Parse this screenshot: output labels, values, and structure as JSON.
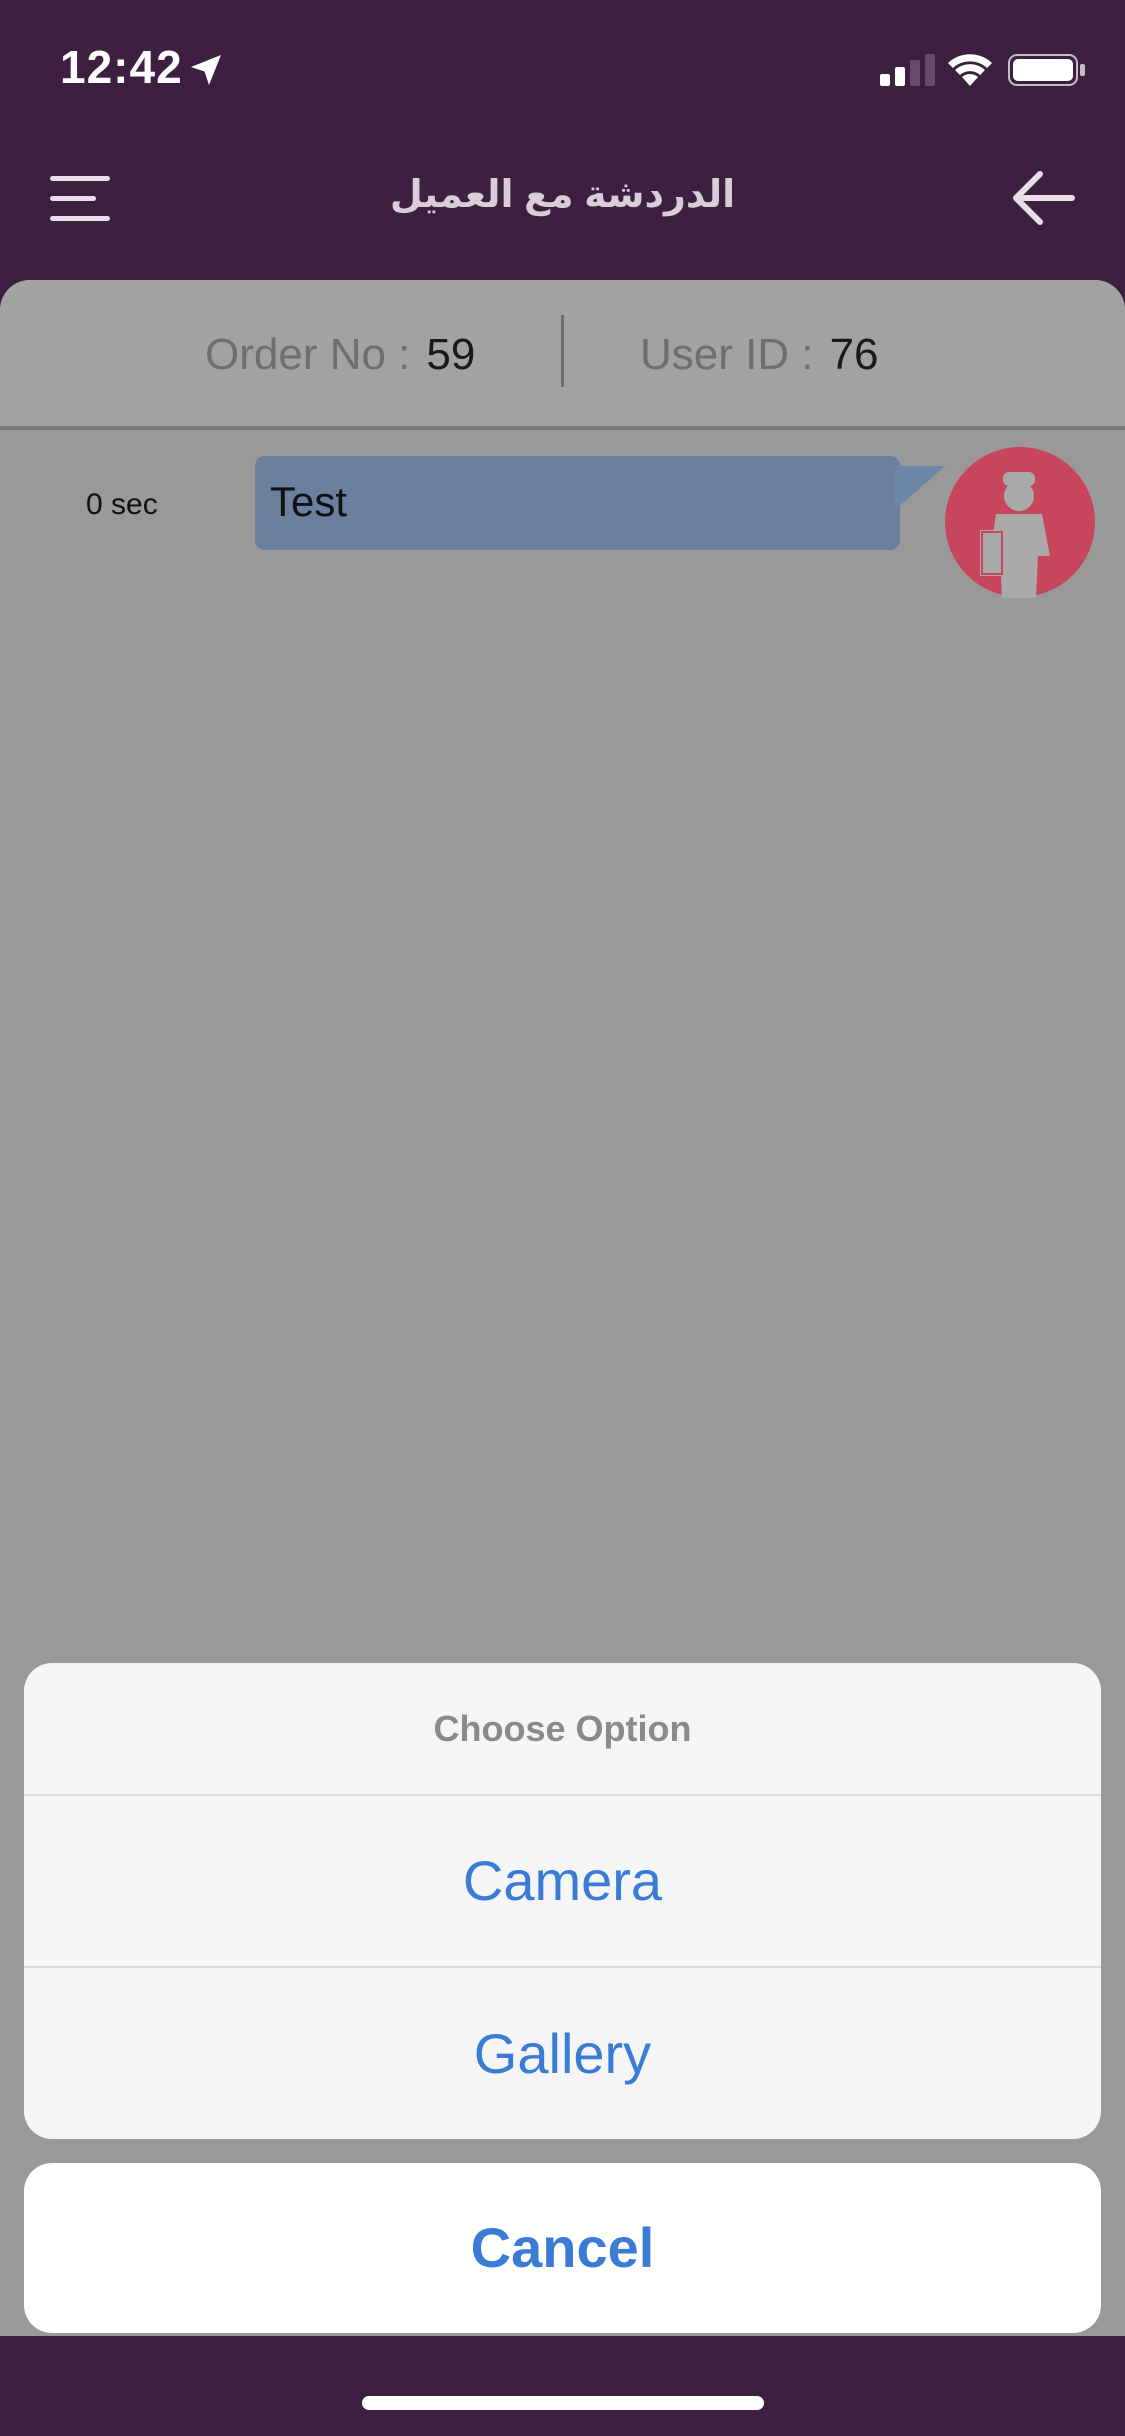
{
  "status_bar": {
    "time": "12:42"
  },
  "header": {
    "title": "الدردشة مع العميل"
  },
  "info": {
    "order_label": "Order No :",
    "order_value": "59",
    "user_label": "User ID :",
    "user_value": "76"
  },
  "messages": [
    {
      "time": "0 sec",
      "text": "Test"
    }
  ],
  "action_sheet": {
    "title": "Choose Option",
    "options": [
      "Camera",
      "Gallery"
    ],
    "cancel": "Cancel"
  },
  "colors": {
    "header_bg": "#3d2040",
    "content_bg": "#999999",
    "bubble_bg": "#6b7f9e",
    "avatar_bg": "#d4455e",
    "action_blue": "#3a7bd5"
  },
  "icons": {
    "menu": "menu-icon",
    "back": "arrow-left-icon",
    "avatar": "delivery-person-icon",
    "location": "location-arrow-icon",
    "signal": "cellular-signal-icon",
    "wifi": "wifi-icon",
    "battery": "battery-icon"
  }
}
